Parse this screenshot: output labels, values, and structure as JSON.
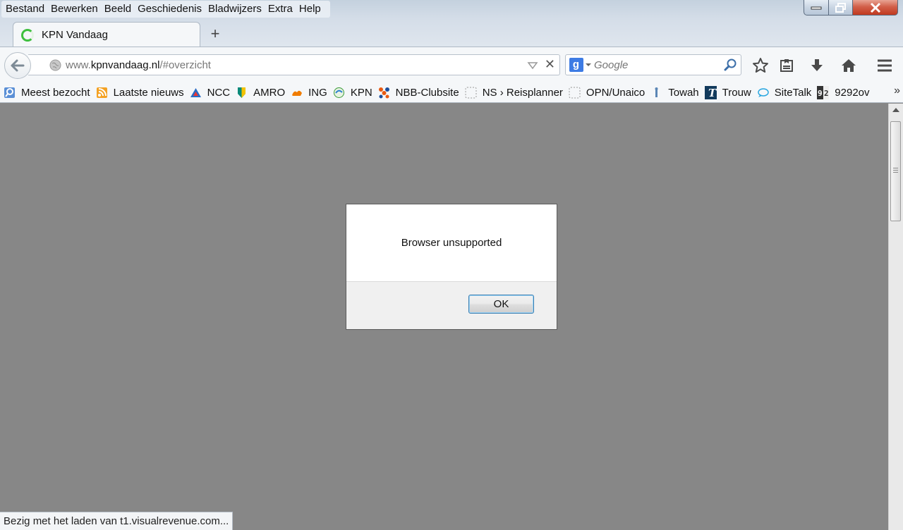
{
  "menubar": {
    "items": [
      {
        "label": "Bestand"
      },
      {
        "label": "Bewerken"
      },
      {
        "label": "Beeld"
      },
      {
        "label": "Geschiedenis"
      },
      {
        "label": "Bladwijzers"
      },
      {
        "label": "Extra"
      },
      {
        "label": "Help"
      }
    ]
  },
  "tab": {
    "title": "KPN Vandaag",
    "new_tab_label": "+"
  },
  "urlbar": {
    "prefix": "www.",
    "domain": "kpnvandaag.nl",
    "path": "/#overzicht",
    "stop_label": "✕"
  },
  "search": {
    "engine": "g",
    "placeholder": "Google"
  },
  "bookmarks": {
    "items": [
      {
        "label": "Meest bezocht",
        "icon": "most-visited-icon"
      },
      {
        "label": "Laatste nieuws",
        "icon": "rss-icon"
      },
      {
        "label": "NCC",
        "icon": "ncc-icon"
      },
      {
        "label": "AMRO",
        "icon": "abn-amro-icon"
      },
      {
        "label": "ING",
        "icon": "ing-lion-icon"
      },
      {
        "label": "KPN",
        "icon": "kpn-icon"
      },
      {
        "label": "NBB-Clubsite",
        "icon": "nbb-icon"
      },
      {
        "label": "NS › Reisplanner",
        "icon": "blank-page-icon"
      },
      {
        "label": "OPN/Unaico",
        "icon": "blank-page-icon"
      },
      {
        "label": "Towah",
        "icon": "towah-icon"
      },
      {
        "label": "Trouw",
        "icon": "trouw-icon"
      },
      {
        "label": "SiteTalk",
        "icon": "sitetalk-icon"
      },
      {
        "label": "9292ov",
        "icon": "9292-icon"
      }
    ],
    "more_label": "»"
  },
  "dialog": {
    "message": "Browser unsupported",
    "ok_label": "OK"
  },
  "status": {
    "text": "Bezig met het laden van t1.visualrevenue.com..."
  },
  "colors": {
    "content_bg": "#878787",
    "dialog_bg": "#ffffff",
    "ok_border": "#3c7fb1",
    "spinner": "#3fbf3f"
  }
}
